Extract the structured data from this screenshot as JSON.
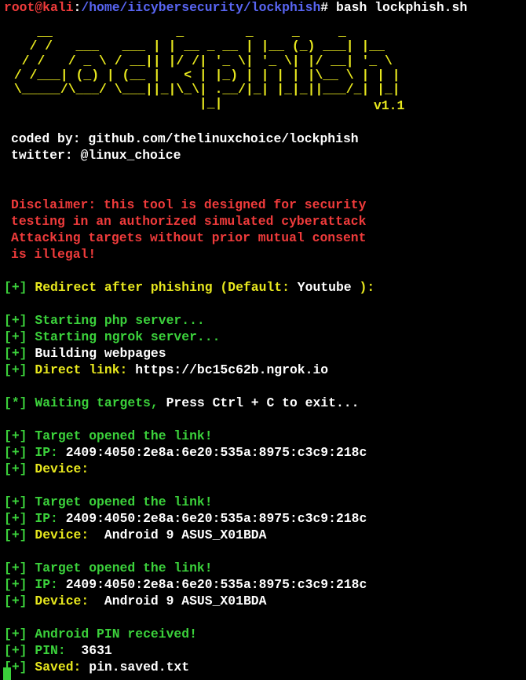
{
  "prompt": {
    "user_host": "root@kali",
    "sep": ":",
    "path": "/home/iicybersecurity/lockphish",
    "hash": "#",
    "command": " bash lockphish.sh"
  },
  "banner": {
    "art": "    __                _        _     _     _     \n   / /   ___   ___ | | __ _ __ | |__ (_) ___| |__  \n  / /   / _ \\ / __|| |/ /| '_ \\| '_ \\| |/ __| '_ \\ \n / /___| (_) | (__ |   < | |_) | | | | |\\__ \\ | | |\n \\_____/\\___/ \\___||_|\\_\\| .__/|_| |_|_||___/_| |_|\n                         |_|",
    "version": "v1.1"
  },
  "credits": {
    "coded_label": "coded by: ",
    "coded_value": "github.com/thelinuxchoice/lockphish",
    "twitter_label": "twitter: ",
    "twitter_value": "@linux_choice"
  },
  "disclaimer": [
    "Disclaimer: this tool is designed for security",
    "testing in an authorized simulated cyberattack",
    "Attacking targets without prior mutual consent",
    "is illegal!"
  ],
  "redirect": {
    "prefix": "[+]",
    "text": " Redirect after phishing (Default: ",
    "value": "Youtube",
    "suffix": " ):"
  },
  "startup": {
    "php": "Starting php server...",
    "ngrok": "Starting ngrok server...",
    "building": "Building webpages",
    "direct_label": "Direct link: ",
    "direct_value": "https://bc15c62b.ngrok.io"
  },
  "waiting": {
    "prefix": "[*]",
    "green": " Waiting targets,",
    "white": " Press Ctrl + C to exit..."
  },
  "events": [
    {
      "opened": "Target opened the link!",
      "ip_label": "IP: ",
      "ip": "2409:4050:2e8a:6e20:535a:8975:c3c9:218c",
      "device_label": "Device:",
      "device": ""
    },
    {
      "opened": "Target opened the link!",
      "ip_label": "IP: ",
      "ip": "2409:4050:2e8a:6e20:535a:8975:c3c9:218c",
      "device_label": "Device:",
      "device": "  Android 9 ASUS_X01BDA"
    },
    {
      "opened": "Target opened the link!",
      "ip_label": "IP: ",
      "ip": "2409:4050:2e8a:6e20:535a:8975:c3c9:218c",
      "device_label": "Device:",
      "device": "  Android 9 ASUS_X01BDA"
    }
  ],
  "result": {
    "received": "Android PIN received!",
    "pin_label": "PIN:",
    "pin_value": "  3631",
    "saved_label": "Saved:",
    "saved_value": " pin.saved.txt"
  },
  "bracket_plus": "[+]",
  "colors": {
    "background": "#000000",
    "red": "#ef3b3b",
    "blue": "#5865f2",
    "green": "#3bd13b",
    "yellow": "#e8e81e",
    "white": "#ffffff"
  }
}
